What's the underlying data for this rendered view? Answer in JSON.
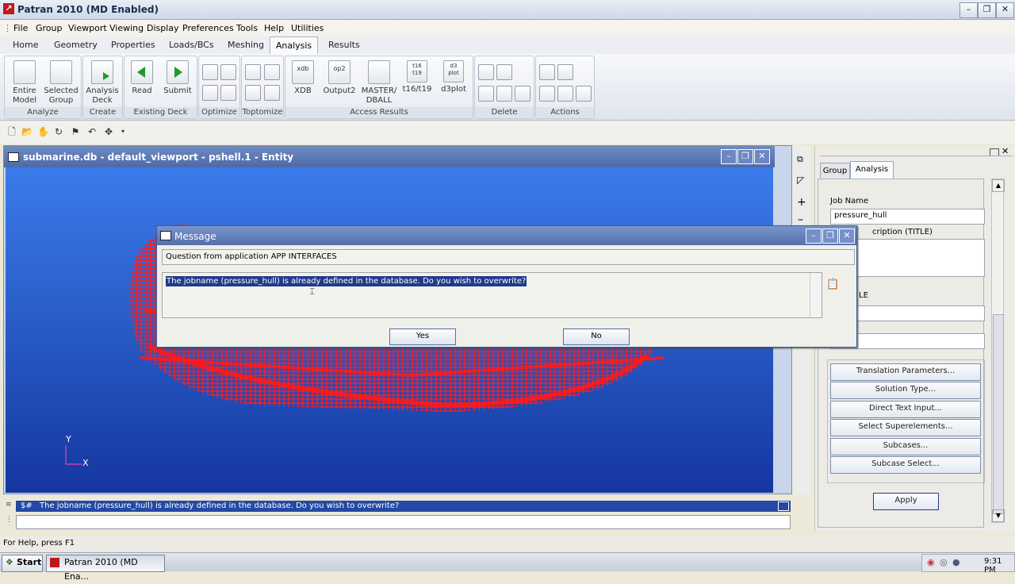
{
  "window": {
    "title": "Patran 2010 (MD Enabled)",
    "minimize": "–",
    "restore": "❐",
    "close": "✕"
  },
  "menu": [
    "File",
    "Group",
    "Viewport",
    "Viewing",
    "Display",
    "Preferences",
    "Tools",
    "Help",
    "Utilities"
  ],
  "ribbon": {
    "tabs": [
      "Home",
      "Geometry",
      "Properties",
      "Loads/BCs",
      "Meshing",
      "Analysis",
      "Results"
    ],
    "active_tab": "Analysis",
    "groups": {
      "analyze": {
        "label": "Analyze",
        "buttons": [
          "Entire\nModel",
          "Selected\nGroup"
        ]
      },
      "create": {
        "label": "Create",
        "buttons": [
          "Analysis\nDeck"
        ]
      },
      "existing": {
        "label": "Existing Deck",
        "buttons": [
          "Read",
          "Submit"
        ]
      },
      "optimize": {
        "label": "Optimize"
      },
      "toptomize": {
        "label": "Toptomize"
      },
      "access": {
        "label": "Access Results",
        "buttons": [
          "XDB",
          "Output2",
          "MASTER/\nDBALL",
          "t16/t19",
          "d3plot"
        ],
        "icon_texts": [
          "xdb",
          "op2",
          "",
          "t16\nt19",
          "d3\nplot"
        ]
      },
      "delete": {
        "label": "Delete"
      },
      "actions": {
        "label": "Actions"
      }
    }
  },
  "viewport": {
    "title": "submarine.db - default_viewport - pshell.1 - Entity",
    "axis_y": "Y",
    "axis_x": "X",
    "colors": {
      "mesh": "#ff1a1a",
      "background_top": "#3b7bea",
      "background_bottom": "#1536a0"
    }
  },
  "right_panel": {
    "tabs": [
      "Group",
      "Analysis"
    ],
    "active_tab": "Analysis",
    "job_name_label": "Job Name",
    "job_name_value": "pressure_hull",
    "job_description_label": "cription (TITLE)",
    "partial_label": "LE",
    "buttons": [
      "Translation Parameters...",
      "Solution Type...",
      "Direct Text Input...",
      "Select Superelements...",
      "Subcases...",
      "Subcase Select..."
    ],
    "apply": "Apply"
  },
  "dialog": {
    "title": "Message",
    "question": "Question from application APP INTERFACES",
    "message": "The jobname (pressure_hull) is already defined in the database. Do you wish to overwrite?",
    "yes": "Yes",
    "no": "No"
  },
  "command": {
    "history_prefix": "$#",
    "history": "The jobname (pressure_hull) is already defined in the database. Do you wish to overwrite?"
  },
  "status": {
    "help": "For Help, press F1"
  },
  "taskbar": {
    "start": "Start",
    "item": "Patran 2010 (MD Ena...",
    "clock": "9:31 PM"
  }
}
